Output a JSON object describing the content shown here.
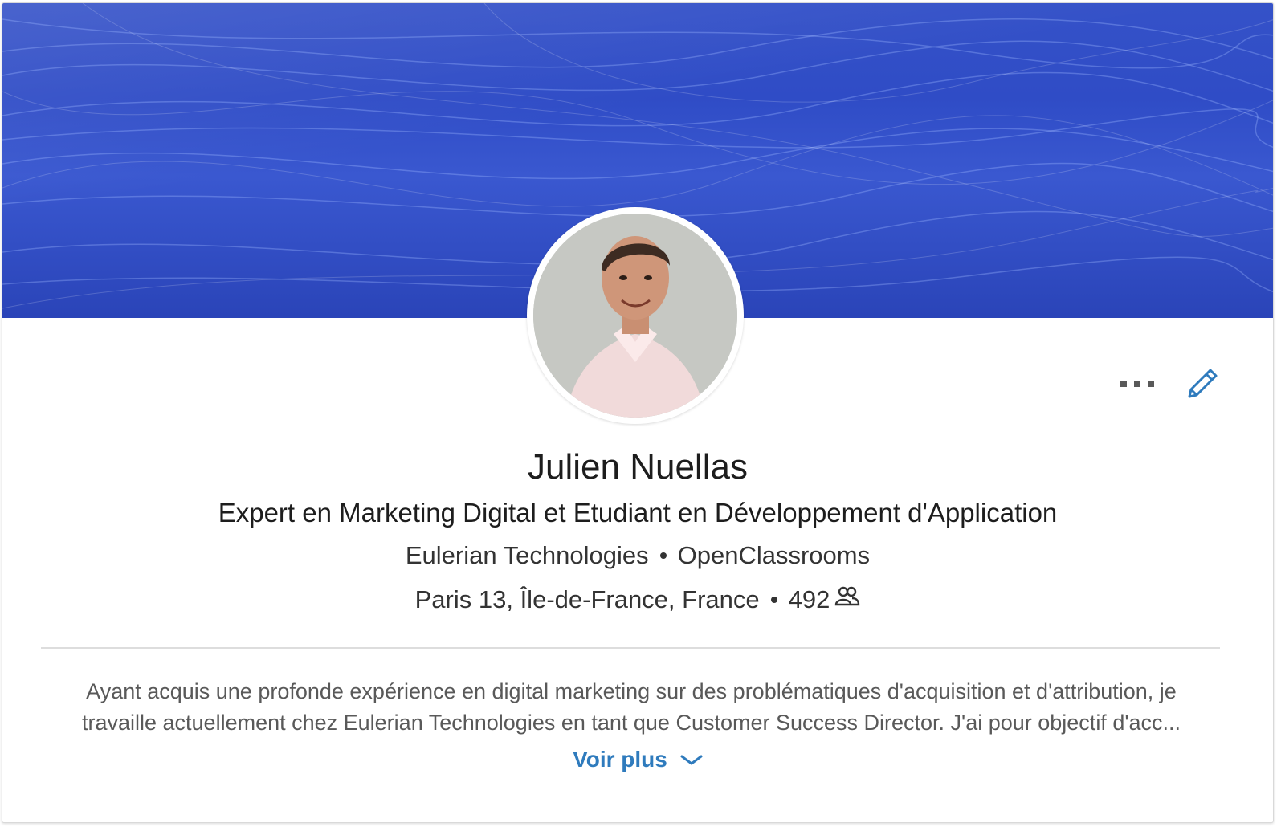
{
  "profile": {
    "name": "Julien Nuellas",
    "headline": "Expert en Marketing Digital et Etudiant en Développement d'Application",
    "company_current": "Eulerian Technologies",
    "company_school": "OpenClassrooms",
    "location": "Paris 13, Île-de-France, France",
    "connections": "492"
  },
  "summary": {
    "line1": "Ayant acquis une profonde expérience en digital marketing sur des problématiques d'acquisition et d'attribution, je",
    "line2": "travaille actuellement chez Eulerian Technologies en tant que Customer Success Director. J'ai pour objectif d'acc..."
  },
  "actions": {
    "see_more_label": "Voir plus",
    "more_icon": "ellipsis-icon",
    "edit_icon": "pencil-icon"
  },
  "colors": {
    "banner": "#3050c8",
    "link": "#2f7bbd",
    "text_primary": "#1d1d1d",
    "text_secondary": "#595959"
  }
}
